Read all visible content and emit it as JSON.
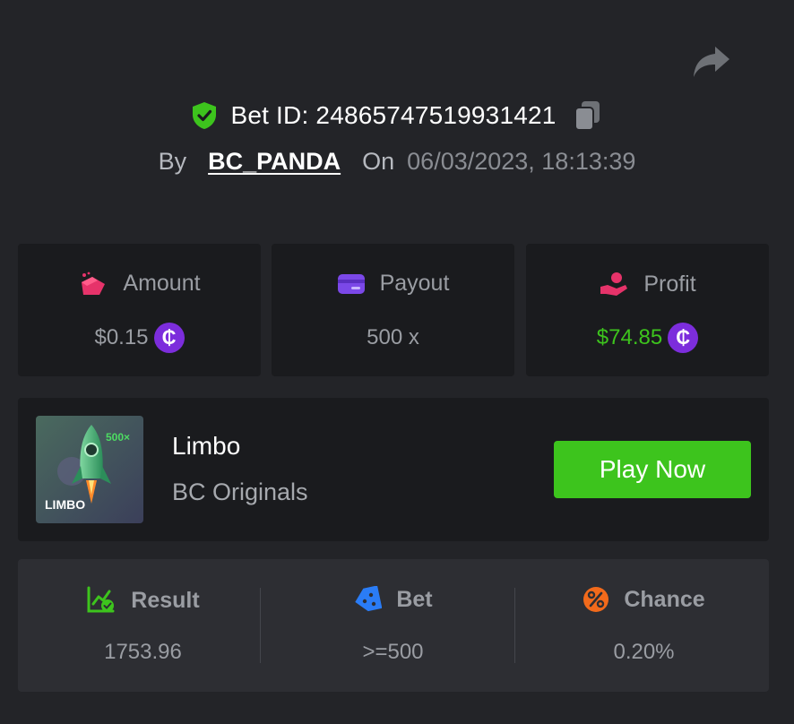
{
  "header": {
    "bet_id_label": "Bet ID: 248657475199314​21",
    "by_label": "By",
    "username": "BC_PANDA",
    "on_label": "On",
    "datetime": "06/03/2023, 18:13:39"
  },
  "stats": [
    {
      "label": "Amount",
      "value": "$0.15",
      "icon": "money-bag-icon",
      "coin": "₵"
    },
    {
      "label": "Payout",
      "value": "500 x",
      "icon": "card-icon"
    },
    {
      "label": "Profit",
      "value": "$74.85",
      "icon": "hand-profit-icon",
      "coin": "₵"
    }
  ],
  "game": {
    "name": "Limbo",
    "provider": "BC Originals",
    "play_label": "Play Now",
    "thumb_title": "LIMBO",
    "thumb_multiplier": "500×"
  },
  "details": [
    {
      "label": "Result",
      "value": "1753.96",
      "icon": "chart-check-icon"
    },
    {
      "label": "Bet",
      "value": ">=500",
      "icon": "ticket-icon"
    },
    {
      "label": "Chance",
      "value": "0.20%",
      "icon": "percent-icon"
    }
  ],
  "colors": {
    "background": "#232428",
    "card": "#1a1b1e",
    "accent_green": "#3dc41d",
    "coin_purple": "#7c2ddc"
  }
}
